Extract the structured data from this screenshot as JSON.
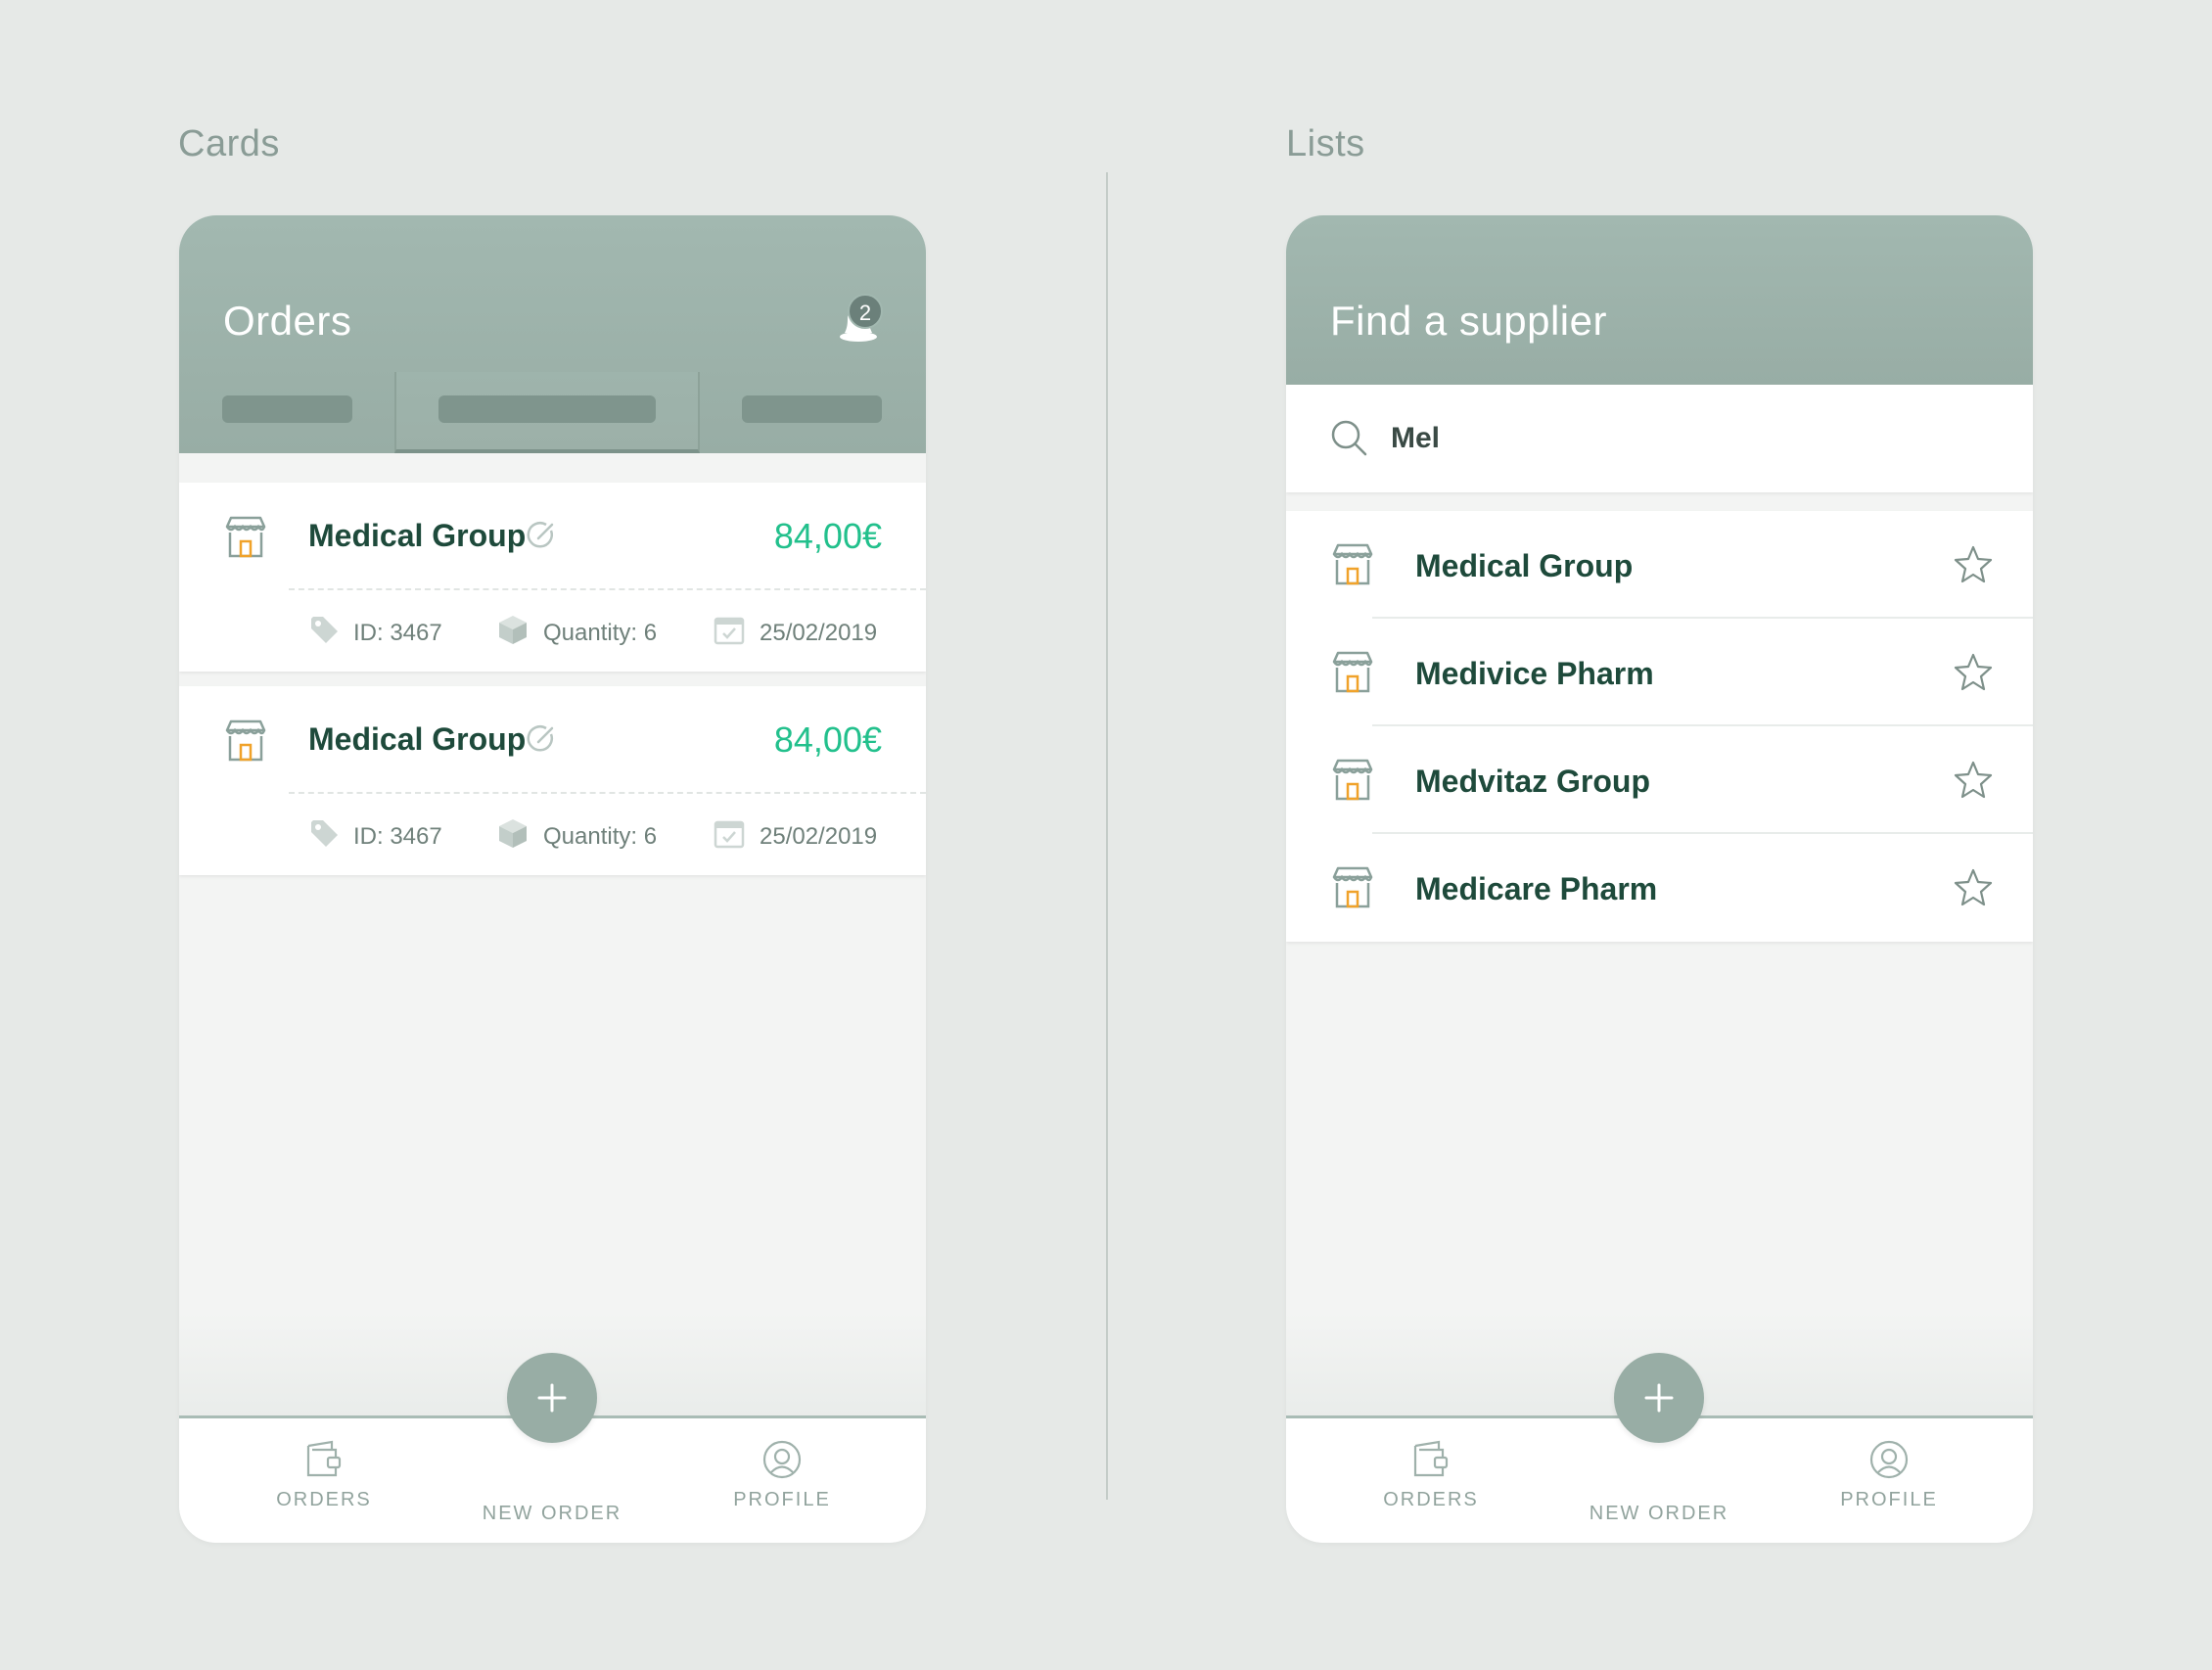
{
  "sections": {
    "cards_title": "Cards",
    "lists_title": "Lists"
  },
  "orders_screen": {
    "title": "Orders",
    "notification_count": "2",
    "tabs": [
      "",
      "",
      ""
    ],
    "cards": [
      {
        "supplier": "Medical Group",
        "price": "84,00€",
        "id": "ID: 3467",
        "quantity": "Quantity: 6",
        "date": "25/02/2019"
      },
      {
        "supplier": "Medical Group",
        "price": "84,00€",
        "id": "ID: 3467",
        "quantity": "Quantity: 6",
        "date": "25/02/2019"
      }
    ]
  },
  "supplier_screen": {
    "title": "Find a supplier",
    "search_value": "Mel",
    "results": [
      {
        "name": "Medical Group"
      },
      {
        "name": "Medivice Pharm"
      },
      {
        "name": "Medvitaz Group"
      },
      {
        "name": "Medicare Pharm"
      }
    ]
  },
  "bottom_nav": {
    "orders": "ORDERS",
    "new_order": "NEW ORDER",
    "profile": "PROFILE"
  },
  "colors": {
    "header": "#a2b8b0",
    "price": "#22c08c",
    "title_text": "#1e4a3b",
    "accent_orange": "#f0a22a"
  },
  "icons": {
    "notification": "bell-icon",
    "shop": "shop-icon",
    "edit": "edit-icon",
    "tag": "tag-icon",
    "box": "box-icon",
    "calendar": "calendar-icon",
    "search": "search-icon",
    "star": "star-icon",
    "orders": "wallet-icon",
    "new_order": "plus-icon",
    "profile": "profile-icon"
  }
}
